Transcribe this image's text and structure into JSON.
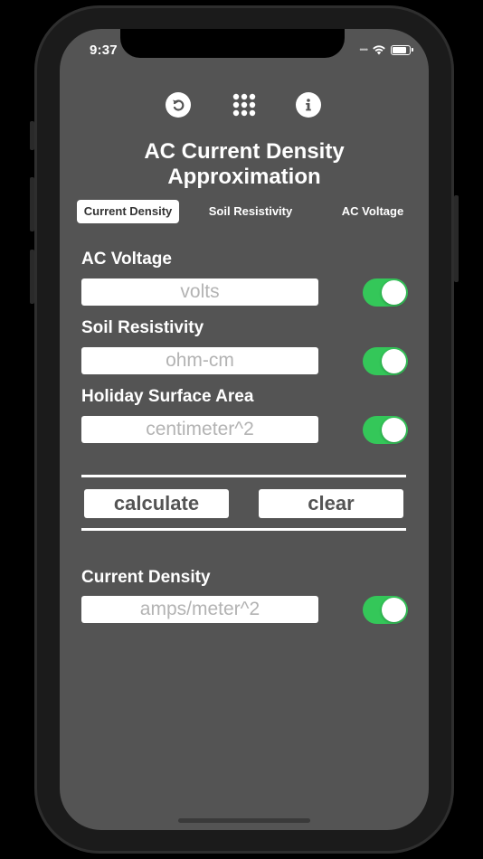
{
  "status_bar": {
    "time": "9:37"
  },
  "toolbar": {
    "icons": [
      "undo-icon",
      "grid-icon",
      "info-icon"
    ]
  },
  "header": {
    "title_line1": "AC Current Density",
    "title_line2": "Approximation"
  },
  "tabs": [
    {
      "label": "Current Density",
      "active": true
    },
    {
      "label": "Soil Resistivity",
      "active": false
    },
    {
      "label": "AC Voltage",
      "active": false
    }
  ],
  "fields": [
    {
      "label": "AC Voltage",
      "placeholder": "volts",
      "value": "",
      "toggle_on": true
    },
    {
      "label": "Soil Resistivity",
      "placeholder": "ohm-cm",
      "value": "",
      "toggle_on": true
    },
    {
      "label": "Holiday Surface Area",
      "placeholder": "centimeter^2",
      "value": "",
      "toggle_on": true
    }
  ],
  "actions": {
    "calculate_label": "calculate",
    "clear_label": "clear"
  },
  "result": {
    "label": "Current Density",
    "placeholder": "amps/meter^2",
    "value": "",
    "toggle_on": true
  },
  "colors": {
    "background": "#545454",
    "toggle_on": "#34c759",
    "text": "#ffffff"
  }
}
